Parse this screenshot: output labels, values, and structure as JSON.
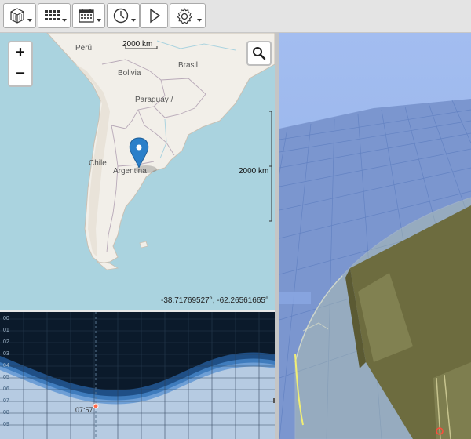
{
  "toolbar": {
    "buttons": [
      {
        "name": "cube-view-button",
        "icon": "cube-icon",
        "dropdown": true
      },
      {
        "name": "grid-view-button",
        "icon": "grid-icon",
        "dropdown": true
      },
      {
        "name": "calendar-button",
        "icon": "calendar-icon",
        "dropdown": true
      },
      {
        "name": "clock-button",
        "icon": "clock-icon",
        "dropdown": true
      },
      {
        "name": "play-button",
        "icon": "play-icon",
        "dropdown": false
      },
      {
        "name": "settings-button",
        "icon": "gear-icon",
        "dropdown": true
      }
    ]
  },
  "map": {
    "zoom_in": "+",
    "zoom_out": "−",
    "labels": {
      "peru": "Perú",
      "bolivia": "Bolivia",
      "brasil": "Brasil",
      "paraguay": "Paraguay /",
      "chile": "Chile",
      "argentina": "Argentina"
    },
    "scale_top": "2000 km",
    "scale_right": "2000 km",
    "coordinates": "-38.71769527°, -62.26561665°",
    "marker": "map-pin-icon"
  },
  "timeline": {
    "hours": [
      "00",
      "01",
      "02",
      "03",
      "04",
      "05",
      "06",
      "07",
      "08",
      "09"
    ],
    "sun_time": "07:57"
  },
  "colors": {
    "ocean": "#aad3df",
    "land": "#f2efe9",
    "sky": "#9fb9ee",
    "building": "#6d6c3f",
    "marker": "#2a7fc9"
  }
}
